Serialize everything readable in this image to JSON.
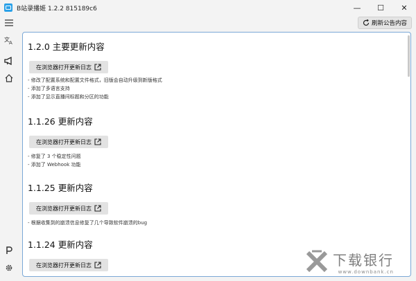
{
  "window": {
    "title": "B站录播姬 1.2.2 815189c6",
    "minimize": "—",
    "maximize": "☐",
    "close": "✕"
  },
  "sidebar": {
    "items": [
      {
        "icon": "menu-icon"
      },
      {
        "icon": "translate-icon"
      },
      {
        "icon": "announcement-icon"
      },
      {
        "icon": "home-icon"
      },
      {
        "icon": "logo-icon"
      },
      {
        "icon": "gear-icon"
      }
    ]
  },
  "toolbar": {
    "refresh_label": "刷新公告内容"
  },
  "sections": [
    {
      "version": "1.2.0 主要更新内容",
      "button": "在浏览器打开更新日志",
      "items": [
        "- 修改了配置系统和配置文件格式，旧版会自动升级到新版格式",
        "- 添加了多语言支持",
        "- 添加了显示直播间标题和分区的功能"
      ]
    },
    {
      "version": "1.1.26 更新内容",
      "button": "在浏览器打开更新日志",
      "items": [
        "- 修复了 3 个稳定性问题",
        "- 添加了 Webhook 功能"
      ]
    },
    {
      "version": "1.1.25 更新内容",
      "button": "在浏览器打开更新日志",
      "items": [
        "- 根据收集到的崩溃信息修复了几个导致软件崩溃的bug"
      ]
    },
    {
      "version": "1.1.24 更新内容",
      "button": "在浏览器打开更新日志",
      "items": []
    }
  ],
  "watermark": {
    "cn": "下载银行",
    "en": "www.downbank.cn"
  }
}
